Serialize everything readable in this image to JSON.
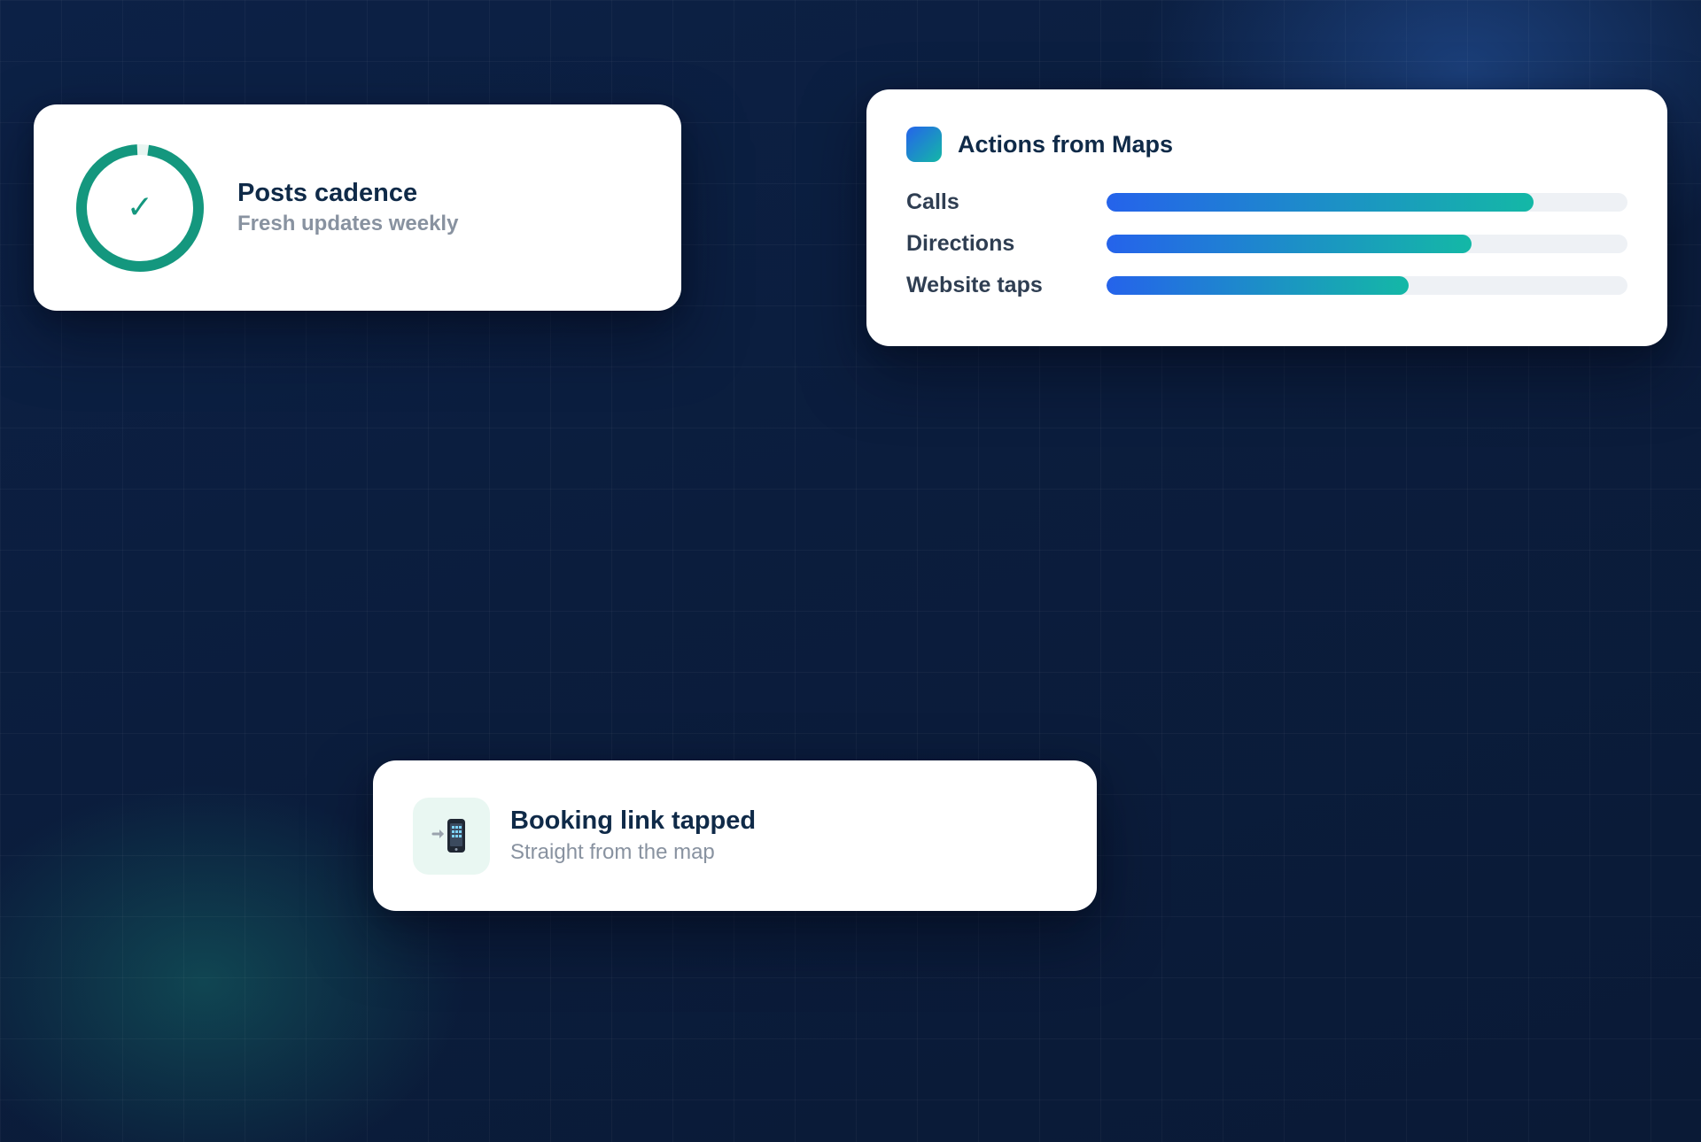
{
  "cadence_card": {
    "title": "Posts cadence",
    "subtitle": "Fresh updates weekly",
    "ring_progress": 0.97,
    "check_glyph": "✓",
    "icon": "check-icon",
    "accent_color": "#14977e"
  },
  "actions_card": {
    "title": "Actions from Maps",
    "icon": "app-icon",
    "bar_gradient": [
      "#2563eb",
      "#14b8a6"
    ],
    "metrics": [
      {
        "label": "Calls",
        "value": 0.82
      },
      {
        "label": "Directions",
        "value": 0.7
      },
      {
        "label": "Website taps",
        "value": 0.58
      }
    ]
  },
  "booking_card": {
    "title": "Booking link tapped",
    "subtitle": "Straight from the map",
    "icon": "mobile-arrow-icon"
  }
}
